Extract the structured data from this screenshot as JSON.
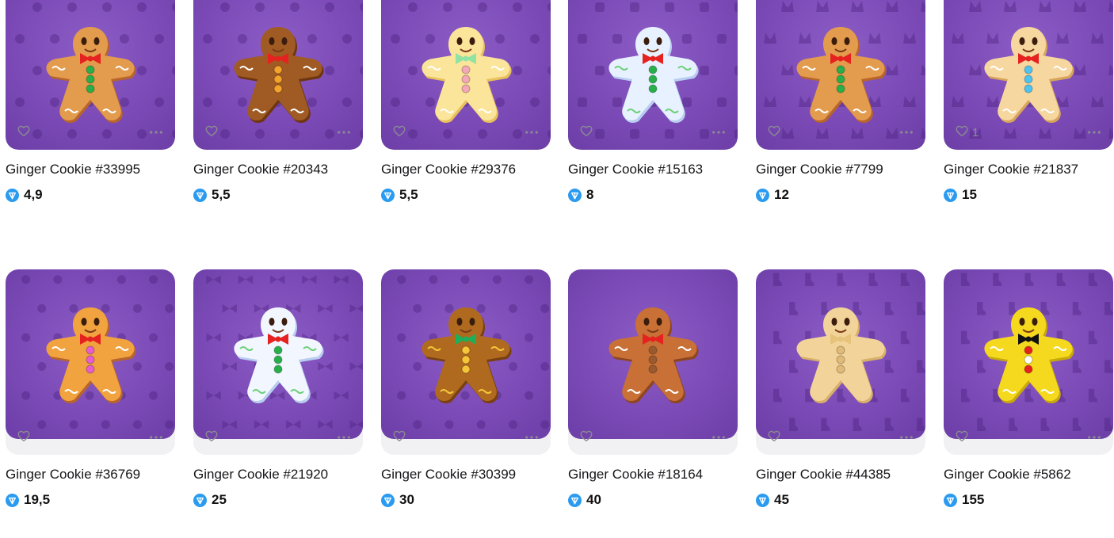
{
  "colors": {
    "art_background": "#7a49b5",
    "card_background": "#f1f1f4",
    "ton_badge": "#2a9bf0",
    "icon_grey": "#8a8a92"
  },
  "items": [
    {
      "name": "Ginger Cookie #33995",
      "price": "4,9",
      "likes": "",
      "body": "#e39b4d",
      "edge": "#b8652b",
      "bow": "#e5221f",
      "buttons": [
        "#27b04a",
        "#27b04a",
        "#27b04a"
      ],
      "icing": "#ffffff",
      "pattern": "leaf"
    },
    {
      "name": "Ginger Cookie #20343",
      "price": "5,5",
      "likes": "",
      "body": "#a05a23",
      "edge": "#6e3610",
      "bow": "#e5221f",
      "buttons": [
        "#f2a32b",
        "#f2a32b",
        "#f2a32b"
      ],
      "icing": "#ffffff",
      "pattern": "cookie"
    },
    {
      "name": "Ginger Cookie #29376",
      "price": "5,5",
      "likes": "",
      "body": "#fbe59a",
      "edge": "#e8c15c",
      "bow": "#8fe3a3",
      "buttons": [
        "#f4a7b6",
        "#f4a7b6",
        "#f4a7b6"
      ],
      "icing": "#ffffff",
      "pattern": "mushroom"
    },
    {
      "name": "Ginger Cookie #15163",
      "price": "8",
      "likes": "",
      "body": "#e8f1ff",
      "edge": "#b8cdf0",
      "bow": "#e5221f",
      "buttons": [
        "#27b04a",
        "#27b04a",
        "#27b04a"
      ],
      "icing": "#6ed07a",
      "pattern": "dice"
    },
    {
      "name": "Ginger Cookie #7799",
      "price": "12",
      "likes": "",
      "body": "#e39b4d",
      "edge": "#b8652b",
      "bow": "#e5221f",
      "buttons": [
        "#27b04a",
        "#27b04a",
        "#27b04a"
      ],
      "icing": "#ffffff",
      "pattern": "cat"
    },
    {
      "name": "Ginger Cookie #21837",
      "price": "15",
      "likes": "1",
      "body": "#f6d7a0",
      "edge": "#d7a45b",
      "bow": "#e5221f",
      "buttons": [
        "#4cc3f0",
        "#4cc3f0",
        "#4cc3f0"
      ],
      "icing": "#ffffff",
      "pattern": "bunny"
    },
    {
      "name": "Ginger Cookie #36769",
      "price": "19,5",
      "likes": "",
      "body": "#f0a33f",
      "edge": "#b8652b",
      "bow": "#e5221f",
      "buttons": [
        "#e85cd0",
        "#e85cd0",
        "#e85cd0"
      ],
      "icing": "#ffffff",
      "pattern": "gingerman"
    },
    {
      "name": "Ginger Cookie #21920",
      "price": "25",
      "likes": "",
      "body": "#f2f6ff",
      "edge": "#b8cdf0",
      "bow": "#e5221f",
      "buttons": [
        "#27b04a",
        "#27b04a",
        "#27b04a"
      ],
      "icing": "#6ed07a",
      "pattern": "bow"
    },
    {
      "name": "Ginger Cookie #30399",
      "price": "30",
      "likes": "",
      "body": "#b06a1f",
      "edge": "#7a4010",
      "bow": "#1fae5a",
      "buttons": [
        "#f6c63a",
        "#f6c63a",
        "#f6c63a"
      ],
      "icing": "#f6c63a",
      "pattern": "rocket"
    },
    {
      "name": "Ginger Cookie #18164",
      "price": "40",
      "likes": "",
      "body": "#c87036",
      "edge": "#8e4620",
      "bow": "#e5221f",
      "buttons": [
        "#9a5a30",
        "#9a5a30",
        "#9a5a30"
      ],
      "icing": "#ffffff",
      "pattern": "none"
    },
    {
      "name": "Ginger Cookie #44385",
      "price": "45",
      "likes": "",
      "body": "#f2d49a",
      "edge": "#d7b069",
      "bow": "#e6c27a",
      "buttons": [
        "#e0bb78",
        "#e0bb78",
        "#e0bb78"
      ],
      "icing": "#f2d49a",
      "pattern": "sock"
    },
    {
      "name": "Ginger Cookie #5862",
      "price": "155",
      "likes": "",
      "body": "#f5d91e",
      "edge": "#c9a90a",
      "bow": "#111111",
      "buttons": [
        "#e5221f",
        "#ffffff",
        "#e5221f"
      ],
      "icing": "#ffffff",
      "pattern": "sock"
    }
  ]
}
